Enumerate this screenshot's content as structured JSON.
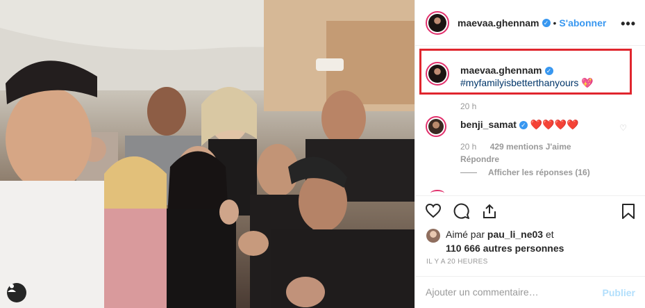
{
  "post": {
    "author": "maevaa.ghennam",
    "follow_label": "S'abonner",
    "separator": "•",
    "more_icon": "ellipsis-icon"
  },
  "caption": {
    "author": "maevaa.ghennam",
    "hashtag": "#myfamilyisbetterthanyours",
    "emoji": "💖",
    "time": "20 h"
  },
  "comment": {
    "author": "benji_samat",
    "text": "❤️❤️❤️❤️",
    "time": "20 h",
    "likes": "429 mentions J'aime",
    "reply_label": "Répondre",
    "view_replies": "Afficher les réponses (16)"
  },
  "likes": {
    "prefix": "Aimé par",
    "user": "pau_li_ne03",
    "and": "et",
    "others": "110 666 autres personnes"
  },
  "date": "IL Y A 20 HEURES",
  "add_comment": {
    "placeholder": "Ajouter un commentaire…",
    "publish_label": "Publier"
  },
  "colors": {
    "highlight": "#e0262e",
    "link": "#3897f0",
    "hashtag": "#003569"
  },
  "icons": [
    "heart-icon",
    "comment-icon",
    "share-icon",
    "bookmark-icon",
    "user-tag-icon",
    "verified-icon"
  ]
}
